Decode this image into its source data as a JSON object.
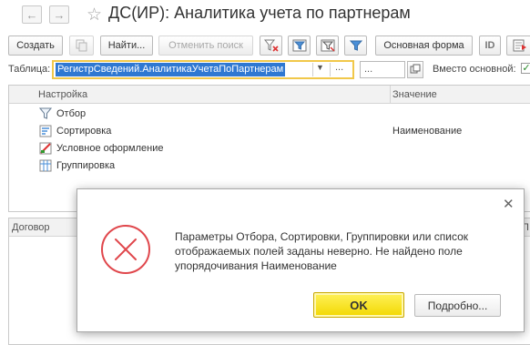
{
  "window": {
    "title": "ДС(ИР): Аналитика учета по партнерам"
  },
  "nav": {
    "back_icon": "arrow-left-icon",
    "forward_icon": "arrow-right-icon",
    "favorite_icon": "star-icon"
  },
  "toolbar": {
    "create_label": "Создать",
    "find_label": "Найти...",
    "cancel_search_label": "Отменить поиск",
    "main_form_label": "Основная форма",
    "id_label": "ID"
  },
  "table_selector": {
    "label": "Таблица:",
    "value": "РегистрСведений.АналитикаУчетаПоПартнерам",
    "dots": "...",
    "secondary_value": "...",
    "instead_label": "Вместо основной:",
    "instead_checked": true
  },
  "settings_grid": {
    "columns": [
      "Настройка",
      "Значение"
    ],
    "rows": [
      {
        "name": "Отбор",
        "value": "",
        "icon": "filter-icon"
      },
      {
        "name": "Сортировка",
        "value": "Наименование",
        "icon": "sort-icon"
      },
      {
        "name": "Условное оформление",
        "value": "",
        "icon": "conditional-format-icon"
      },
      {
        "name": "Группировка",
        "value": "",
        "icon": "grouping-icon"
      }
    ]
  },
  "list": {
    "columns": [
      "Договор",
      "П"
    ]
  },
  "dialog": {
    "message": "Параметры Отбора, Сортировки, Группировки или список отображаемых полей заданы неверно. Не найдено поле упорядочивания Наименование",
    "ok_label": "OK",
    "details_label": "Подробно...",
    "close_icon": "close-icon",
    "error_icon": "error-icon",
    "error_color": "#e0474c"
  }
}
